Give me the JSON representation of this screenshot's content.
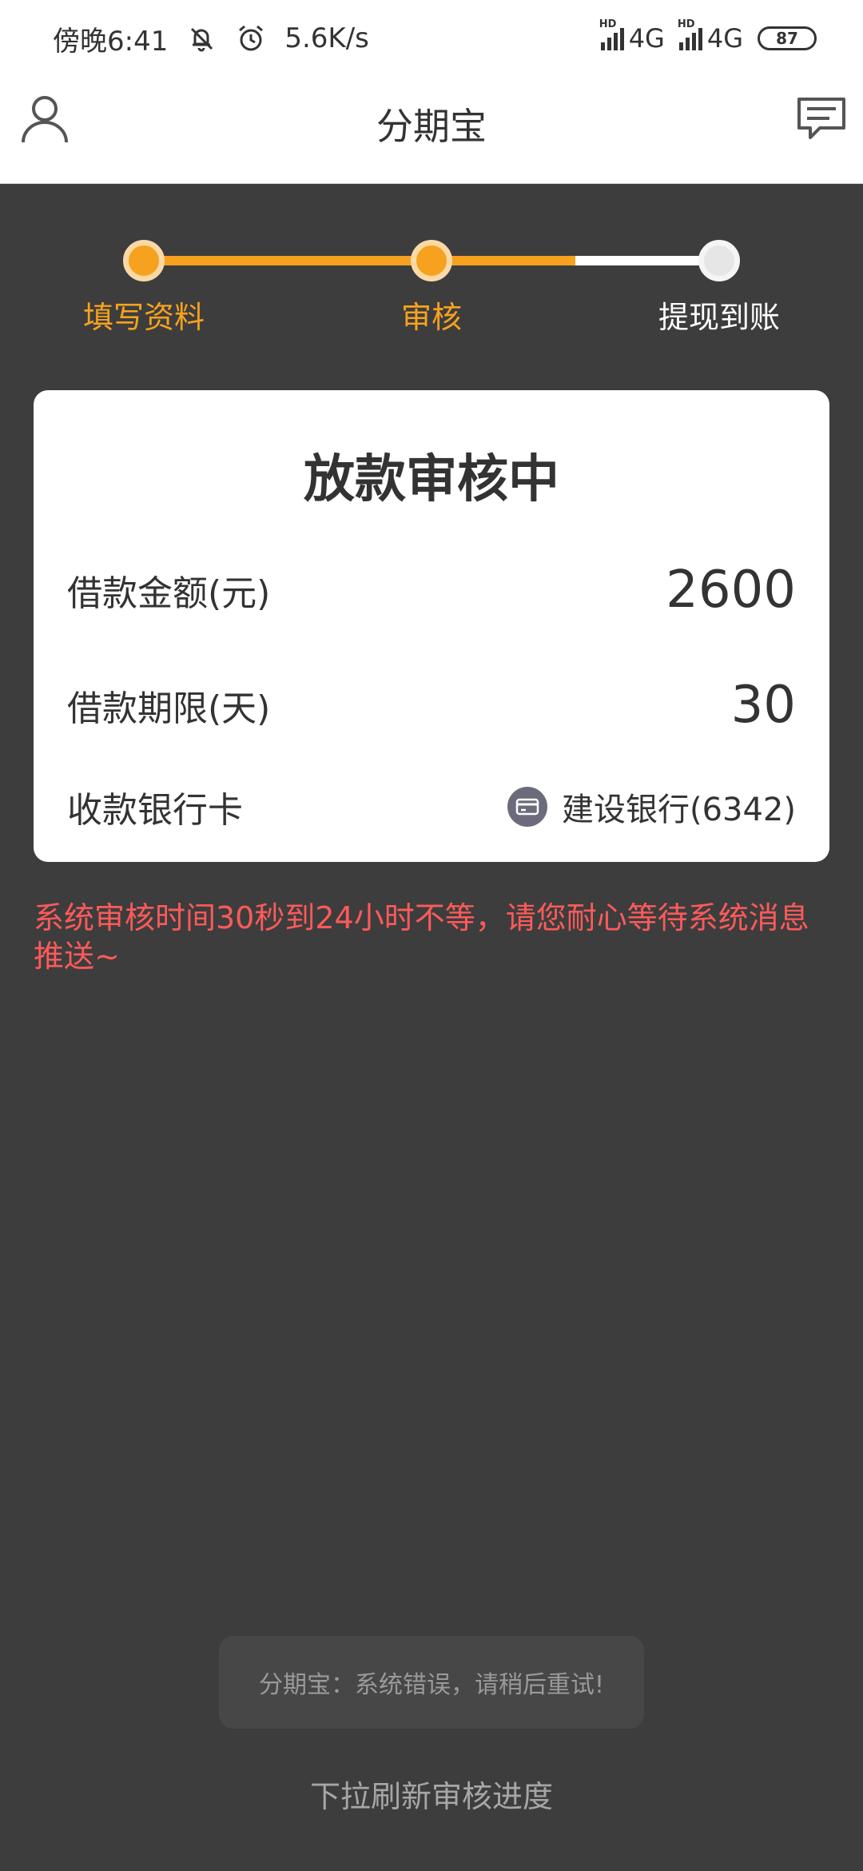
{
  "status_bar": {
    "time": "傍晚6:41",
    "net_speed": "5.6K/s",
    "hd_label": "HD",
    "sim1_network": "4G",
    "sim2_network": "4G",
    "battery": "87",
    "icons": [
      "bell-off-icon",
      "alarm-icon",
      "signal-icon",
      "signal-icon"
    ]
  },
  "header": {
    "title": "分期宝",
    "left_icon": "user-icon",
    "right_icon": "message-icon"
  },
  "stepper": {
    "steps": [
      {
        "label": "填写资料",
        "state": "done"
      },
      {
        "label": "审核",
        "state": "current"
      },
      {
        "label": "提现到账",
        "state": "pending"
      }
    ],
    "accent_color": "#f6a21e"
  },
  "card": {
    "title": "放款审核中",
    "amount_label": "借款金额(元)",
    "amount_value": "2600",
    "term_label": "借款期限(天)",
    "term_value": "30",
    "bank_label": "收款银行卡",
    "bank_value": "建设银行(6342)",
    "bank_icon": "bank-card-icon"
  },
  "notice": "系统审核时间30秒到24小时不等，请您耐心等待系统消息推送~",
  "toast": "分期宝：系统错误，请稍后重试!",
  "refresh_hint": "下拉刷新审核进度",
  "colors": {
    "background": "#3d3d3d",
    "accent": "#f6a21e",
    "notice": "#ff5a5a"
  }
}
